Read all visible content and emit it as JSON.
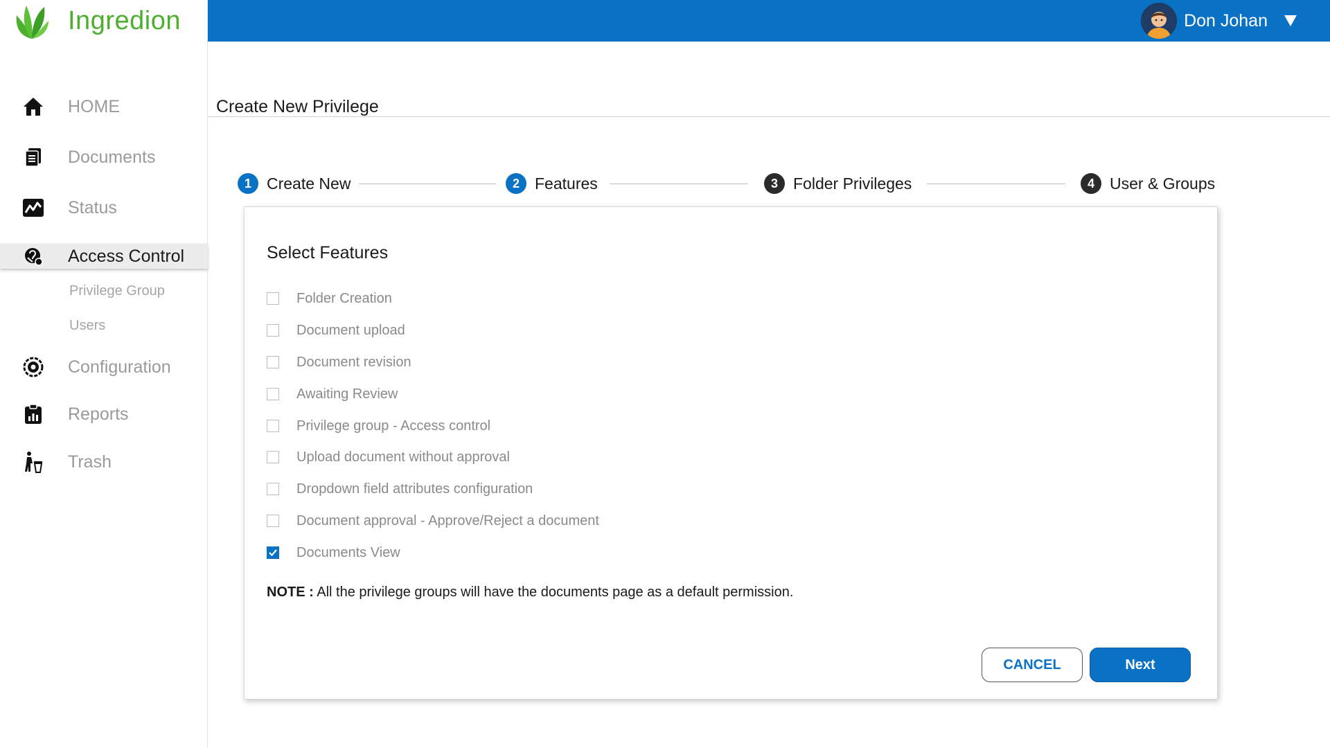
{
  "brand": {
    "name": "Ingredion",
    "logo_color": "#4caf2e"
  },
  "topbar": {
    "color": "#0a72c4",
    "user_name": "Don Johan",
    "menu_icon": "caret-down-icon"
  },
  "sidebar": {
    "items": [
      {
        "label": "HOME",
        "icon": "home-icon"
      },
      {
        "label": "Documents",
        "icon": "documents-icon"
      },
      {
        "label": "Status",
        "icon": "status-chart-icon"
      },
      {
        "label": "Access Control",
        "icon": "access-control-icon",
        "active": true
      },
      {
        "label": "Configuration",
        "icon": "configuration-icon"
      },
      {
        "label": "Reports",
        "icon": "reports-icon"
      },
      {
        "label": "Trash",
        "icon": "trash-icon"
      }
    ],
    "sub_items": [
      {
        "label": "Privilege Group"
      },
      {
        "label": "Users"
      }
    ]
  },
  "page": {
    "title": "Create New Privilege"
  },
  "stepper": [
    {
      "number": "1",
      "label": "Create New",
      "state": "done"
    },
    {
      "number": "2",
      "label": "Features",
      "state": "current"
    },
    {
      "number": "3",
      "label": "Folder Privileges",
      "state": "pending"
    },
    {
      "number": "4",
      "label": "User & Groups",
      "state": "pending"
    }
  ],
  "card": {
    "title": "Select Features",
    "features": [
      {
        "label": "Folder Creation",
        "checked": false
      },
      {
        "label": "Document upload",
        "checked": false
      },
      {
        "label": "Document revision",
        "checked": false
      },
      {
        "label": "Awaiting Review",
        "checked": false
      },
      {
        "label": "Privilege group - Access control",
        "checked": false
      },
      {
        "label": "Upload document without approval",
        "checked": false
      },
      {
        "label": "Dropdown field attributes configuration",
        "checked": false
      },
      {
        "label": "Document approval - Approve/Reject a document",
        "checked": false
      },
      {
        "label": "Documents View",
        "checked": true
      }
    ],
    "note_label": "NOTE :",
    "note_text": " All the privilege groups will have the documents page as a default permission.",
    "cancel_label": "CANCEL",
    "next_label": "Next"
  }
}
